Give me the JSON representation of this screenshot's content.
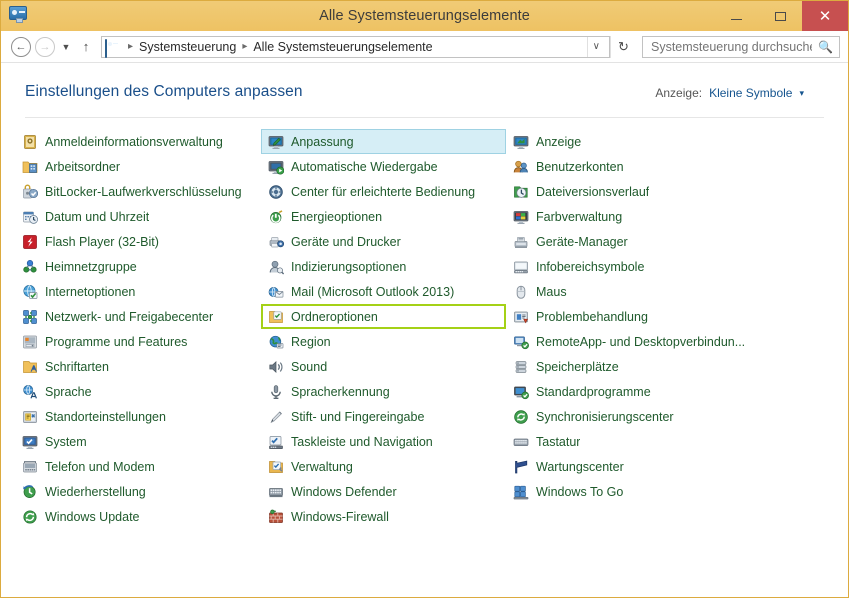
{
  "window": {
    "title": "Alle Systemsteuerungselemente",
    "app_icon": "control-panel-icon",
    "border_color": "#eec464",
    "titlebar_color": "#eec263",
    "close_color": "#c75050"
  },
  "titlebar_buttons": {
    "minimize": "–",
    "maximize": "❑",
    "close": "✕"
  },
  "addressbar": {
    "back": "←",
    "forward": "→",
    "recent": "▼",
    "up": "↑",
    "crumb_icon": "control-panel-icon",
    "crumbs": [
      "Systemsteuerung",
      "Alle Systemsteuerungselemente"
    ],
    "separator": "▸",
    "dropdown": "∨",
    "refresh": "↻",
    "search_placeholder": "Systemsteuerung durchsuchen",
    "search_value": "",
    "search_icon": "search-icon"
  },
  "header": {
    "title": "Einstellungen des Computers anpassen",
    "view_label": "Anzeige:",
    "view_value": "Kleine Symbole",
    "view_caret": "▾",
    "title_color": "#1a4f8a",
    "link_color": "#16558f"
  },
  "items": {
    "text_color": "#1f5a2c",
    "selected_bg": "#d6eef6",
    "selected_border": "#9fd2e3",
    "highlight_border": "#a4d117",
    "column1": [
      {
        "label": "Anmeldeinformationsverwaltung",
        "icon": "credential-manager-icon",
        "state": "normal"
      },
      {
        "label": "Arbeitsordner",
        "icon": "work-folders-icon",
        "state": "normal"
      },
      {
        "label": "BitLocker-Laufwerkverschlüsselung",
        "icon": "bitlocker-icon",
        "state": "normal"
      },
      {
        "label": "Datum und Uhrzeit",
        "icon": "date-time-icon",
        "state": "normal"
      },
      {
        "label": "Flash Player (32-Bit)",
        "icon": "flash-player-icon",
        "state": "normal"
      },
      {
        "label": "Heimnetzgruppe",
        "icon": "homegroup-icon",
        "state": "normal"
      },
      {
        "label": "Internetoptionen",
        "icon": "internet-options-icon",
        "state": "normal"
      },
      {
        "label": "Netzwerk- und Freigabecenter",
        "icon": "network-sharing-icon",
        "state": "normal"
      },
      {
        "label": "Programme und Features",
        "icon": "programs-features-icon",
        "state": "normal"
      },
      {
        "label": "Schriftarten",
        "icon": "fonts-icon",
        "state": "normal"
      },
      {
        "label": "Sprache",
        "icon": "language-icon",
        "state": "normal"
      },
      {
        "label": "Standorteinstellungen",
        "icon": "location-settings-icon",
        "state": "normal"
      },
      {
        "label": "System",
        "icon": "system-icon",
        "state": "normal"
      },
      {
        "label": "Telefon und Modem",
        "icon": "phone-modem-icon",
        "state": "normal"
      },
      {
        "label": "Wiederherstellung",
        "icon": "recovery-icon",
        "state": "normal"
      },
      {
        "label": "Windows Update",
        "icon": "windows-update-icon",
        "state": "normal"
      }
    ],
    "column2": [
      {
        "label": "Anpassung",
        "icon": "personalization-icon",
        "state": "selected"
      },
      {
        "label": "Automatische Wiedergabe",
        "icon": "autoplay-icon",
        "state": "normal"
      },
      {
        "label": "Center für erleichterte Bedienung",
        "icon": "ease-of-access-icon",
        "state": "normal"
      },
      {
        "label": "Energieoptionen",
        "icon": "power-options-icon",
        "state": "normal"
      },
      {
        "label": "Geräte und Drucker",
        "icon": "devices-printers-icon",
        "state": "normal"
      },
      {
        "label": "Indizierungsoptionen",
        "icon": "indexing-options-icon",
        "state": "normal"
      },
      {
        "label": "Mail (Microsoft Outlook 2013)",
        "icon": "mail-icon",
        "state": "normal"
      },
      {
        "label": "Ordneroptionen",
        "icon": "folder-options-icon",
        "state": "highlighted"
      },
      {
        "label": "Region",
        "icon": "region-icon",
        "state": "normal"
      },
      {
        "label": "Sound",
        "icon": "sound-icon",
        "state": "normal"
      },
      {
        "label": "Spracherkennung",
        "icon": "speech-recognition-icon",
        "state": "normal"
      },
      {
        "label": "Stift- und Fingereingabe",
        "icon": "pen-touch-icon",
        "state": "normal"
      },
      {
        "label": "Taskleiste und Navigation",
        "icon": "taskbar-navigation-icon",
        "state": "normal"
      },
      {
        "label": "Verwaltung",
        "icon": "administrative-tools-icon",
        "state": "normal"
      },
      {
        "label": "Windows Defender",
        "icon": "windows-defender-icon",
        "state": "normal"
      },
      {
        "label": "Windows-Firewall",
        "icon": "windows-firewall-icon",
        "state": "normal"
      }
    ],
    "column3": [
      {
        "label": "Anzeige",
        "icon": "display-icon",
        "state": "normal"
      },
      {
        "label": "Benutzerkonten",
        "icon": "user-accounts-icon",
        "state": "normal"
      },
      {
        "label": "Dateiversionsverlauf",
        "icon": "file-history-icon",
        "state": "normal"
      },
      {
        "label": "Farbverwaltung",
        "icon": "color-management-icon",
        "state": "normal"
      },
      {
        "label": "Geräte-Manager",
        "icon": "device-manager-icon",
        "state": "normal"
      },
      {
        "label": "Infobereichsymbole",
        "icon": "notification-area-icon",
        "state": "normal"
      },
      {
        "label": "Maus",
        "icon": "mouse-icon",
        "state": "normal"
      },
      {
        "label": "Problembehandlung",
        "icon": "troubleshooting-icon",
        "state": "normal"
      },
      {
        "label": "RemoteApp- und Desktopverbindun...",
        "icon": "remoteapp-icon",
        "state": "normal"
      },
      {
        "label": "Speicherplätze",
        "icon": "storage-spaces-icon",
        "state": "normal"
      },
      {
        "label": "Standardprogramme",
        "icon": "default-programs-icon",
        "state": "normal"
      },
      {
        "label": "Synchronisierungscenter",
        "icon": "sync-center-icon",
        "state": "normal"
      },
      {
        "label": "Tastatur",
        "icon": "keyboard-icon",
        "state": "normal"
      },
      {
        "label": "Wartungscenter",
        "icon": "action-center-icon",
        "state": "normal"
      },
      {
        "label": "Windows To Go",
        "icon": "windows-to-go-icon",
        "state": "normal"
      }
    ]
  }
}
